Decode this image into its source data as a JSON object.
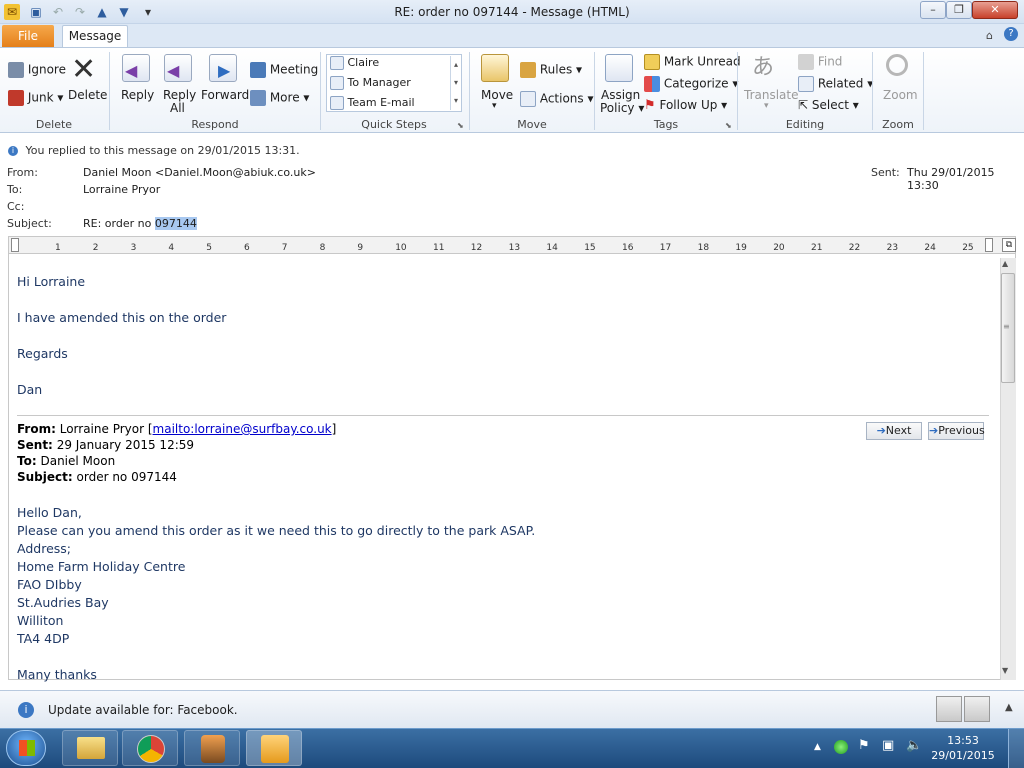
{
  "window": {
    "title": "RE: order no 097144  -  Message (HTML)",
    "minimize": "–",
    "restore": "❐",
    "close": "✕"
  },
  "tabs": {
    "file": "File",
    "message": "Message"
  },
  "ribbon": {
    "delete_group": {
      "label": "Delete",
      "ignore": "Ignore",
      "junk": "Junk",
      "delete": "Delete"
    },
    "respond_group": {
      "label": "Respond",
      "reply": "Reply",
      "reply_all_1": "Reply",
      "reply_all_2": "All",
      "forward": "Forward",
      "meeting": "Meeting",
      "more": "More"
    },
    "quicksteps_group": {
      "label": "Quick Steps",
      "items": [
        "Claire",
        "To Manager",
        "Team E-mail"
      ]
    },
    "move_group": {
      "label": "Move",
      "move": "Move",
      "rules": "Rules",
      "actions": "Actions"
    },
    "tags_group": {
      "label": "Tags",
      "assign_policy_1": "Assign",
      "assign_policy_2": "Policy",
      "mark_unread": "Mark Unread",
      "categorize": "Categorize",
      "follow_up": "Follow Up"
    },
    "editing_group": {
      "label": "Editing",
      "translate": "Translate",
      "find": "Find",
      "related": "Related",
      "select": "Select"
    },
    "zoom_group": {
      "label": "Zoom",
      "zoom": "Zoom"
    }
  },
  "header": {
    "info": "You replied to this message on 29/01/2015 13:31.",
    "from_label": "From:",
    "from_value": "Daniel Moon <Daniel.Moon@abiuk.co.uk>",
    "to_label": "To:",
    "to_value": "Lorraine Pryor",
    "cc_label": "Cc:",
    "subject_label": "Subject:",
    "subject_prefix": "RE: order no ",
    "subject_highlight": "097144",
    "sent_label": "Sent:",
    "sent_value": "Thu 29/01/2015 13:30"
  },
  "ruler_ticks": [
    "1",
    "2",
    "3",
    "4",
    "5",
    "6",
    "7",
    "8",
    "9",
    "10",
    "11",
    "12",
    "13",
    "14",
    "15",
    "16",
    "17",
    "18",
    "19",
    "20",
    "21",
    "22",
    "23",
    "24",
    "25"
  ],
  "body": {
    "reply_lines": [
      "Hi Lorraine",
      "I have amended this on the order",
      "Regards",
      "Dan"
    ],
    "quoted_header": {
      "from_label": "From:",
      "from_name": "Lorraine Pryor [",
      "from_link": "mailto:lorraine@surfbay.co.uk",
      "from_close": "]",
      "sent_label": "Sent:",
      "sent_value": "29 January 2015 12:59",
      "to_label": "To:",
      "to_value": "Daniel Moon",
      "subject_label": "Subject:",
      "subject_value": "order no 097144"
    },
    "quoted_lines": [
      "Hello Dan,",
      "Please can you amend this order as it we need this to go directly to the park ASAP.",
      "Address;",
      "Home Farm Holiday Centre",
      "FAO DIbby",
      "St.Audries Bay",
      "Williton",
      "TA4 4DP",
      "Many thanks"
    ],
    "next_button": "Next",
    "previous_button": "Previous"
  },
  "update_bar": {
    "text": "Update available for: Facebook."
  },
  "taskbar": {
    "time": "13:53",
    "date": "29/01/2015"
  },
  "colors": {
    "accent_file_tab": "#e47f1a",
    "body_text": "#1f3864",
    "link": "#0000cc",
    "taskbar": "#1d4a7c"
  }
}
